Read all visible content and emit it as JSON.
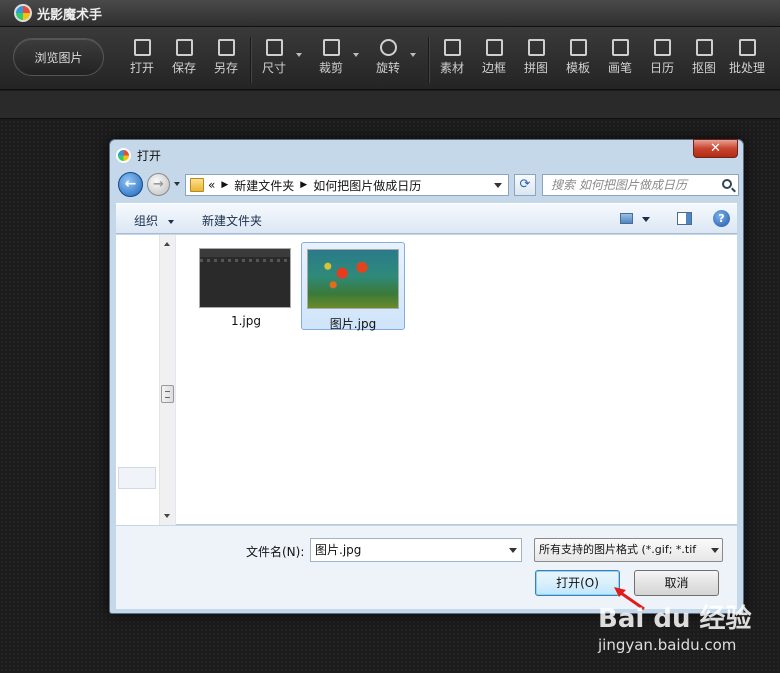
{
  "app": {
    "title": "光影魔术手"
  },
  "toolbar": {
    "browse_label": "浏览图片",
    "tools": [
      {
        "label": "打开",
        "icon": "open-icon"
      },
      {
        "label": "保存",
        "icon": "save-icon"
      },
      {
        "label": "另存",
        "icon": "save-as-icon"
      },
      {
        "label": "尺寸",
        "icon": "resize-icon"
      },
      {
        "label": "裁剪",
        "icon": "crop-icon"
      },
      {
        "label": "旋转",
        "icon": "rotate-icon"
      },
      {
        "label": "素材",
        "icon": "material-icon"
      },
      {
        "label": "边框",
        "icon": "frame-icon"
      },
      {
        "label": "拼图",
        "icon": "collage-icon"
      },
      {
        "label": "模板",
        "icon": "template-icon"
      },
      {
        "label": "画笔",
        "icon": "brush-icon"
      },
      {
        "label": "日历",
        "icon": "calendar-icon"
      },
      {
        "label": "抠图",
        "icon": "cutout-icon"
      },
      {
        "label": "批处理",
        "icon": "batch-icon"
      }
    ]
  },
  "dialog": {
    "title": "打开",
    "close_label": "✕",
    "address": {
      "prefix": "«",
      "crumbs": [
        "新建文件夹",
        "如何把图片做成日历"
      ]
    },
    "search_placeholder": "搜索 如何把图片做成日历",
    "commands": {
      "organize": "组织",
      "new_folder": "新建文件夹"
    },
    "files": [
      {
        "name": "1.jpg",
        "selected": false
      },
      {
        "name": "图片.jpg",
        "selected": true
      }
    ],
    "filename_label": "文件名(N):",
    "filename_value": "图片.jpg",
    "filetype_value": "所有支持的图片格式 (*.gif; *.tif",
    "open_button": "打开(O)",
    "cancel_button": "取消"
  },
  "watermark": {
    "logo": "Bai du 经验",
    "url": "jingyan.baidu.com"
  },
  "colors": {
    "accent_red": "#e01b1b",
    "dialog_frame": "#c5d8ea",
    "selection": "#cfe4fa"
  }
}
